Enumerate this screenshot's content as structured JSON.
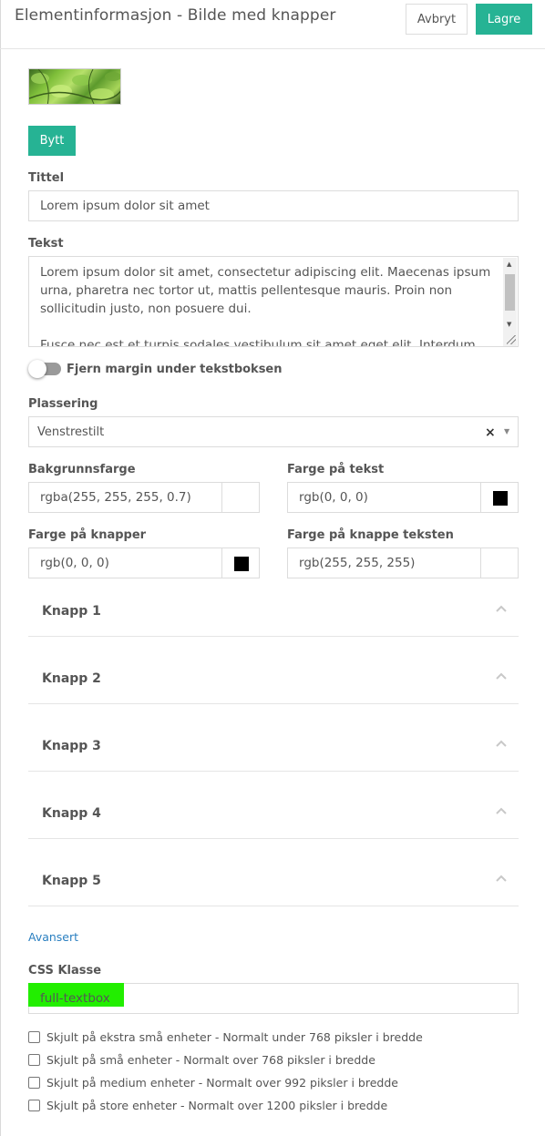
{
  "header": {
    "title": "Elementinformasjon - Bilde med knapper",
    "cancel_label": "Avbryt",
    "save_label": "Lagre"
  },
  "image": {
    "swap_label": "Bytt"
  },
  "title_field": {
    "label": "Tittel",
    "value": "Lorem ipsum dolor sit amet"
  },
  "text_field": {
    "label": "Tekst",
    "paragraph1": "Lorem ipsum dolor sit amet, consectetur adipiscing elit. Maecenas ipsum urna, pharetra nec tortor ut, mattis pellentesque mauris. Proin non sollicitudin justo, non posuere dui.",
    "paragraph2": "Fusce nec est et turpis sodales vestibulum sit amet eget elit. Interdum"
  },
  "margin_toggle": {
    "label": "Fjern margin under tekstboksen",
    "on": false
  },
  "placement": {
    "label": "Plassering",
    "value": "Venstrestilt",
    "clear": "×",
    "caret": "▼"
  },
  "colors": {
    "background": {
      "label": "Bakgrunnsfarge",
      "value": "rgba(255, 255, 255, 0.7)",
      "swatch": "#ffffff"
    },
    "text": {
      "label": "Farge på tekst",
      "value": "rgb(0, 0, 0)",
      "swatch": "#000000"
    },
    "buttons": {
      "label": "Farge på knapper",
      "value": "rgb(0, 0, 0)",
      "swatch": "#000000"
    },
    "button_text": {
      "label": "Farge på knappe teksten",
      "value": "rgb(255, 255, 255)",
      "swatch": "#ffffff"
    }
  },
  "accordion": [
    {
      "label": "Knapp 1"
    },
    {
      "label": "Knapp 2"
    },
    {
      "label": "Knapp 3"
    },
    {
      "label": "Knapp 4"
    },
    {
      "label": "Knapp 5"
    }
  ],
  "advanced_link": "Avansert",
  "css_class": {
    "label": "CSS Klasse",
    "value": "full-textbox",
    "highlight_color": "#22ee00"
  },
  "visibility": [
    {
      "label": "Skjult på ekstra små enheter - Normalt under 768 piksler i bredde",
      "checked": false
    },
    {
      "label": "Skjult på små enheter - Normalt over 768 piksler i bredde",
      "checked": false
    },
    {
      "label": "Skjult på medium enheter - Normalt over 992 piksler i bredde",
      "checked": false
    },
    {
      "label": "Skjult på store enheter - Normalt over 1200 piksler i bredde",
      "checked": false
    }
  ],
  "theme": {
    "accent": "#26b394",
    "link": "#2a7fc0"
  }
}
